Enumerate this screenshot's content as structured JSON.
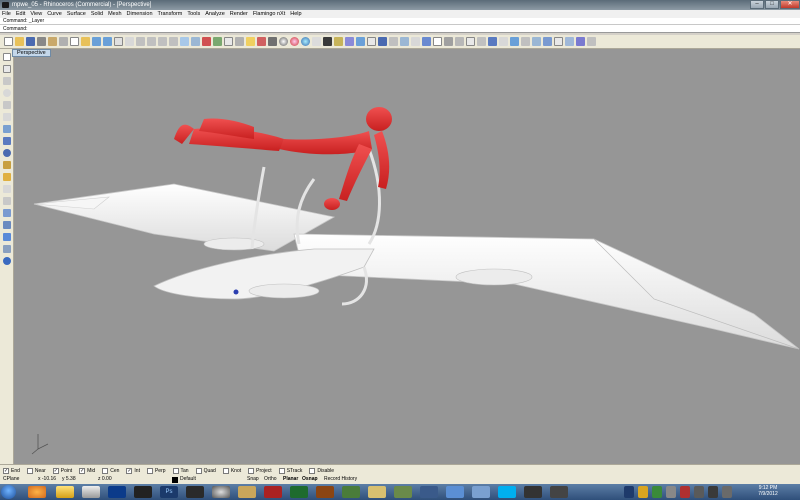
{
  "window": {
    "title": "mpwe_05 - Rhinoceros (Commercial) - [Perspective]",
    "controls": {
      "minimize": "–",
      "maximize": "□",
      "close": "✕"
    }
  },
  "menu": [
    "File",
    "Edit",
    "View",
    "Curve",
    "Surface",
    "Solid",
    "Mesh",
    "Dimension",
    "Transform",
    "Tools",
    "Analyze",
    "Render",
    "Flamingo nXt",
    "Help"
  ],
  "command": {
    "history": "Command: _Layer",
    "prompt": "Command:",
    "value": ""
  },
  "viewport": {
    "label": "Perspective",
    "background": "#969696",
    "axis_glyph": "z y x"
  },
  "osnaps": [
    {
      "label": "End",
      "checked": true
    },
    {
      "label": "Near",
      "checked": false
    },
    {
      "label": "Point",
      "checked": true
    },
    {
      "label": "Mid",
      "checked": true
    },
    {
      "label": "Cen",
      "checked": false
    },
    {
      "label": "Int",
      "checked": true
    },
    {
      "label": "Perp",
      "checked": false
    },
    {
      "label": "Tan",
      "checked": false
    },
    {
      "label": "Quad",
      "checked": false
    },
    {
      "label": "Knot",
      "checked": false
    },
    {
      "label": "Project",
      "checked": false
    },
    {
      "label": "STrack",
      "checked": false
    },
    {
      "label": "Disable",
      "checked": false
    }
  ],
  "status": {
    "cplane": "CPlane",
    "x": "x -10.16",
    "y": "y 5.38",
    "z": "z 0.00",
    "layer": "Default",
    "snap": "Snap",
    "ortho": "Ortho",
    "planar": "Planar",
    "osnap": "Osnap",
    "record_history": "Record History"
  },
  "taskbar": {
    "time": "9:12 PM",
    "date": "7/9/2012"
  },
  "colors": {
    "figure": "#e63b3b",
    "aircraft": "#f4f4f4",
    "selection_tab": "#c4d7ea"
  }
}
